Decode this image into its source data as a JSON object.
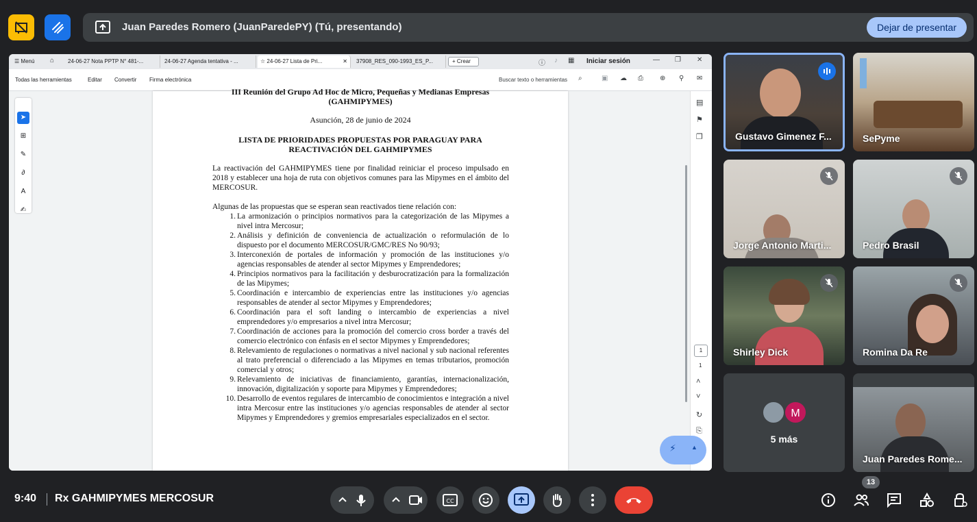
{
  "presenting": {
    "text": "Juan Paredes Romero (JuanParedePY) (Tú, presentando)",
    "stop_label": "Dejar de presentar"
  },
  "browser": {
    "menu_label": "Menú",
    "tabs": [
      {
        "label": "24-06-27 Nota PPTP N° 481-..."
      },
      {
        "label": "24-06-27 Agenda tentativa - ..."
      },
      {
        "label": "24-06-27 Lista de Pri...",
        "active": true
      },
      {
        "label": "37908_RES_090-1993_ES_P..."
      }
    ],
    "new_tab_label": "Crear",
    "login_label": "Iniciar sesión"
  },
  "pdf_toolbar": {
    "items": [
      "Todas las herramientas",
      "Editar",
      "Convertir",
      "Firma electrónica"
    ],
    "search_placeholder": "Buscar texto o herramientas"
  },
  "document": {
    "header_line1": "III Reunión del Grupo Ad Hoc de Micro, Pequeñas y Medianas Empresas",
    "header_line2": "(GAHMIPYMES)",
    "date": "Asunción, 28 de junio de 2024",
    "title_line1": "LISTA DE PRIORIDADES PROPUESTAS POR PARAGUAY PARA",
    "title_line2": "REACTIVACIÓN DEL GAHMIPYMES",
    "intro": "La reactivación del GAHMIPYMES tiene por finalidad reiniciar el proceso impulsado en 2018 y establecer una hoja de ruta con objetivos comunes para las Mipymes en el ámbito del MERCOSUR.",
    "lead": "Algunas de las propuestas que se esperan sean reactivados tiene relación con:",
    "items": [
      {
        "n": "1.",
        "text": "La armonización o principios normativos para la categorización de las Mipymes a nivel intra Mercosur;"
      },
      {
        "n": "2.",
        "text": "Análisis y definición de conveniencia de actualización o reformulación de lo dispuesto por el documento MERCOSUR/GMC/RES No 90/93;"
      },
      {
        "n": "3.",
        "text": "Interconexión de portales de información y promoción de las instituciones y/o agencias responsables de atender al sector Mipymes y Emprendedores;"
      },
      {
        "n": "4.",
        "text": "Principios normativos para la facilitación y desburocratización para la formalización de las Mipymes;"
      },
      {
        "n": "5.",
        "text": "Coordinación e intercambio de experiencias entre las instituciones y/o agencias responsables de atender al sector Mipymes y Emprendedores;"
      },
      {
        "n": "6.",
        "text": "Coordinación para el soft landing o intercambio de experiencias a nivel emprendedores y/o empresarios a nivel intra Mercosur;"
      },
      {
        "n": "7.",
        "text": "Coordinación de acciones para la promoción del comercio cross border a través del comercio electrónico con énfasis en el sector Mipymes y Emprendedores;"
      },
      {
        "n": "8.",
        "text": "Relevamiento de regulaciones o normativas a nivel nacional y sub nacional referentes al trato preferencial o diferenciado a las Mipymes en temas tributarios, promoción comercial y otros;"
      },
      {
        "n": "9.",
        "text": "Relevamiento de iniciativas de financiamiento, garantías, internacionalización, innovación, digitalización y soporte para Mipymes y Emprendedores;"
      },
      {
        "n": "10.",
        "text": "Desarrollo de eventos regulares de intercambio de conocimientos e integración a nivel intra Mercosur entre las instituciones y/o agencias responsables de atender al sector Mipymes y Emprendedores y gremios empresariales especializados en el sector."
      }
    ],
    "page_current": "1",
    "page_total": "1"
  },
  "participants": [
    {
      "name": "Gustavo Gimenez F...",
      "state": "speaking"
    },
    {
      "name": "SePyme",
      "state": "none"
    },
    {
      "name": "Jorge Antonio Marti...",
      "state": "muted"
    },
    {
      "name": "Pedro Brasil",
      "state": "muted"
    },
    {
      "name": "Shirley Dick",
      "state": "muted"
    },
    {
      "name": "Romina Da Re",
      "state": "muted"
    },
    {
      "name": "Juan Paredes Rome...",
      "state": "none"
    }
  ],
  "more_tile": {
    "label": "5 más",
    "avatar_letter": "M"
  },
  "bottom": {
    "time": "9:40",
    "meeting_name": "Rx GAHMIPYMES MERCOSUR",
    "people_count": "13"
  },
  "colors": {
    "meet_bg": "#202124",
    "tile_bg": "#3c4043",
    "accent_blue": "#a8c7fa",
    "hangup_red": "#ea4335",
    "highlight_border": "#8ab4f8"
  }
}
